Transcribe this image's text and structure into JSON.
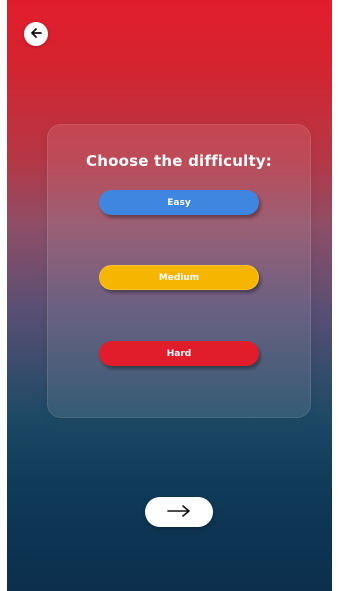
{
  "header": {
    "back_icon": "arrow-left-icon"
  },
  "difficulty": {
    "title": "Choose the difficulty:",
    "options": [
      {
        "label": "Easy",
        "color": "#3f86e0"
      },
      {
        "label": "Medium",
        "color": "#f6b500"
      },
      {
        "label": "Hard",
        "color": "#e21d2b"
      }
    ]
  },
  "footer": {
    "next_icon": "arrow-right-icon"
  },
  "colors": {
    "top_gradient": "#e11d2c",
    "bottom_gradient": "#0b2f4d",
    "button_bg": "#ffffff"
  }
}
